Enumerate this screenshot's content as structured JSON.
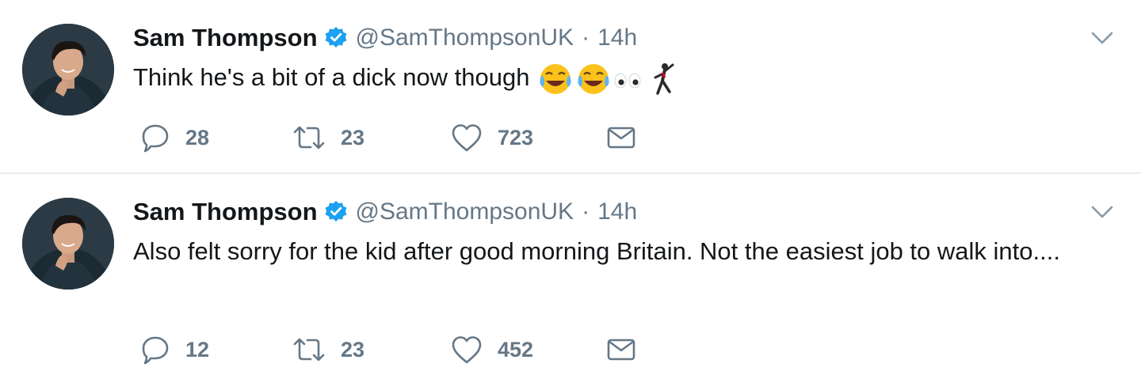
{
  "colors": {
    "verified_blue": "#1da1f2",
    "secondary_text": "#657786",
    "primary_text": "#14171a",
    "divider": "#e6ecf0"
  },
  "tweets": [
    {
      "author": {
        "name": "Sam Thompson",
        "handle": "@SamThompsonUK",
        "verified": true
      },
      "separator": "·",
      "time": "14h",
      "text": "Think he's a bit of a dick now though",
      "emoji": [
        "face-with-tears-of-joy",
        "face-with-tears-of-joy",
        "eyes",
        "man-dancing"
      ],
      "stats": {
        "replies": "28",
        "retweets": "23",
        "likes": "723"
      }
    },
    {
      "author": {
        "name": "Sam Thompson",
        "handle": "@SamThompsonUK",
        "verified": true
      },
      "separator": "·",
      "time": "14h",
      "text": "Also felt sorry for the kid after good morning Britain. Not the easiest job to walk into....",
      "emoji": [],
      "stats": {
        "replies": "12",
        "retweets": "23",
        "likes": "452"
      }
    }
  ],
  "icons": {
    "reply": "speech-bubble-icon",
    "retweet": "retweet-arrows-icon",
    "like": "heart-icon",
    "dm": "envelope-icon",
    "menu": "chevron-down-icon",
    "verified": "verified-badge-icon"
  }
}
